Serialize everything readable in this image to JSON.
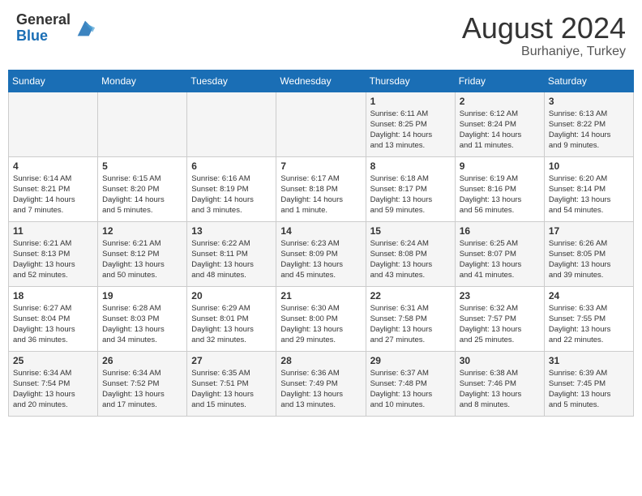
{
  "header": {
    "logo_general": "General",
    "logo_blue": "Blue",
    "month_year": "August 2024",
    "location": "Burhaniye, Turkey"
  },
  "calendar": {
    "days_of_week": [
      "Sunday",
      "Monday",
      "Tuesday",
      "Wednesday",
      "Thursday",
      "Friday",
      "Saturday"
    ],
    "weeks": [
      [
        {
          "day": "",
          "info": ""
        },
        {
          "day": "",
          "info": ""
        },
        {
          "day": "",
          "info": ""
        },
        {
          "day": "",
          "info": ""
        },
        {
          "day": "1",
          "info": "Sunrise: 6:11 AM\nSunset: 8:25 PM\nDaylight: 14 hours\nand 13 minutes."
        },
        {
          "day": "2",
          "info": "Sunrise: 6:12 AM\nSunset: 8:24 PM\nDaylight: 14 hours\nand 11 minutes."
        },
        {
          "day": "3",
          "info": "Sunrise: 6:13 AM\nSunset: 8:22 PM\nDaylight: 14 hours\nand 9 minutes."
        }
      ],
      [
        {
          "day": "4",
          "info": "Sunrise: 6:14 AM\nSunset: 8:21 PM\nDaylight: 14 hours\nand 7 minutes."
        },
        {
          "day": "5",
          "info": "Sunrise: 6:15 AM\nSunset: 8:20 PM\nDaylight: 14 hours\nand 5 minutes."
        },
        {
          "day": "6",
          "info": "Sunrise: 6:16 AM\nSunset: 8:19 PM\nDaylight: 14 hours\nand 3 minutes."
        },
        {
          "day": "7",
          "info": "Sunrise: 6:17 AM\nSunset: 8:18 PM\nDaylight: 14 hours\nand 1 minute."
        },
        {
          "day": "8",
          "info": "Sunrise: 6:18 AM\nSunset: 8:17 PM\nDaylight: 13 hours\nand 59 minutes."
        },
        {
          "day": "9",
          "info": "Sunrise: 6:19 AM\nSunset: 8:16 PM\nDaylight: 13 hours\nand 56 minutes."
        },
        {
          "day": "10",
          "info": "Sunrise: 6:20 AM\nSunset: 8:14 PM\nDaylight: 13 hours\nand 54 minutes."
        }
      ],
      [
        {
          "day": "11",
          "info": "Sunrise: 6:21 AM\nSunset: 8:13 PM\nDaylight: 13 hours\nand 52 minutes."
        },
        {
          "day": "12",
          "info": "Sunrise: 6:21 AM\nSunset: 8:12 PM\nDaylight: 13 hours\nand 50 minutes."
        },
        {
          "day": "13",
          "info": "Sunrise: 6:22 AM\nSunset: 8:11 PM\nDaylight: 13 hours\nand 48 minutes."
        },
        {
          "day": "14",
          "info": "Sunrise: 6:23 AM\nSunset: 8:09 PM\nDaylight: 13 hours\nand 45 minutes."
        },
        {
          "day": "15",
          "info": "Sunrise: 6:24 AM\nSunset: 8:08 PM\nDaylight: 13 hours\nand 43 minutes."
        },
        {
          "day": "16",
          "info": "Sunrise: 6:25 AM\nSunset: 8:07 PM\nDaylight: 13 hours\nand 41 minutes."
        },
        {
          "day": "17",
          "info": "Sunrise: 6:26 AM\nSunset: 8:05 PM\nDaylight: 13 hours\nand 39 minutes."
        }
      ],
      [
        {
          "day": "18",
          "info": "Sunrise: 6:27 AM\nSunset: 8:04 PM\nDaylight: 13 hours\nand 36 minutes."
        },
        {
          "day": "19",
          "info": "Sunrise: 6:28 AM\nSunset: 8:03 PM\nDaylight: 13 hours\nand 34 minutes."
        },
        {
          "day": "20",
          "info": "Sunrise: 6:29 AM\nSunset: 8:01 PM\nDaylight: 13 hours\nand 32 minutes."
        },
        {
          "day": "21",
          "info": "Sunrise: 6:30 AM\nSunset: 8:00 PM\nDaylight: 13 hours\nand 29 minutes."
        },
        {
          "day": "22",
          "info": "Sunrise: 6:31 AM\nSunset: 7:58 PM\nDaylight: 13 hours\nand 27 minutes."
        },
        {
          "day": "23",
          "info": "Sunrise: 6:32 AM\nSunset: 7:57 PM\nDaylight: 13 hours\nand 25 minutes."
        },
        {
          "day": "24",
          "info": "Sunrise: 6:33 AM\nSunset: 7:55 PM\nDaylight: 13 hours\nand 22 minutes."
        }
      ],
      [
        {
          "day": "25",
          "info": "Sunrise: 6:34 AM\nSunset: 7:54 PM\nDaylight: 13 hours\nand 20 minutes."
        },
        {
          "day": "26",
          "info": "Sunrise: 6:34 AM\nSunset: 7:52 PM\nDaylight: 13 hours\nand 17 minutes."
        },
        {
          "day": "27",
          "info": "Sunrise: 6:35 AM\nSunset: 7:51 PM\nDaylight: 13 hours\nand 15 minutes."
        },
        {
          "day": "28",
          "info": "Sunrise: 6:36 AM\nSunset: 7:49 PM\nDaylight: 13 hours\nand 13 minutes."
        },
        {
          "day": "29",
          "info": "Sunrise: 6:37 AM\nSunset: 7:48 PM\nDaylight: 13 hours\nand 10 minutes."
        },
        {
          "day": "30",
          "info": "Sunrise: 6:38 AM\nSunset: 7:46 PM\nDaylight: 13 hours\nand 8 minutes."
        },
        {
          "day": "31",
          "info": "Sunrise: 6:39 AM\nSunset: 7:45 PM\nDaylight: 13 hours\nand 5 minutes."
        }
      ]
    ]
  }
}
